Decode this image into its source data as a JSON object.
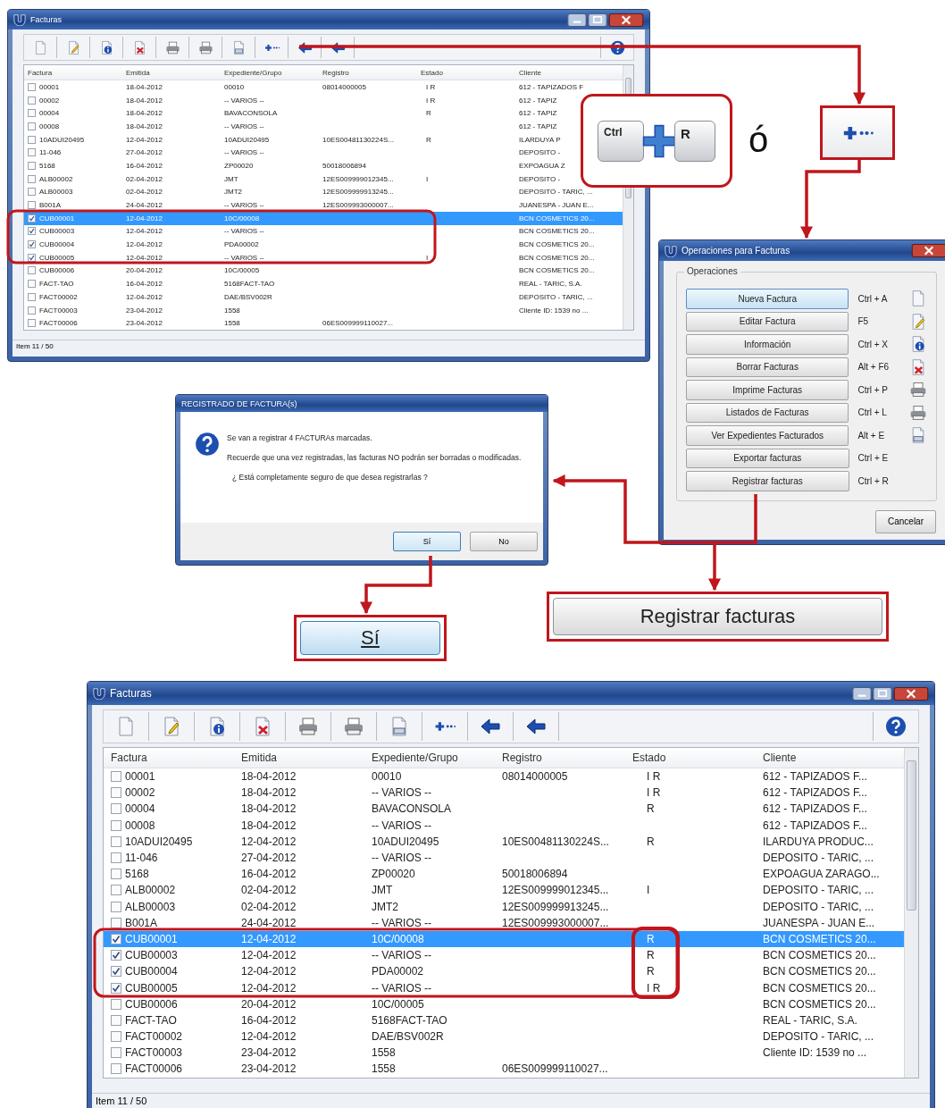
{
  "top_window": {
    "title": "Facturas",
    "columns": [
      "Factura",
      "Emitida",
      "Expediente/Grupo",
      "Registro",
      "Estado",
      "Cliente"
    ],
    "rows": [
      {
        "factura": "00001",
        "emitida": "18-04-2012",
        "expediente": "00010",
        "registro": "08014000005",
        "estado": "I R",
        "cliente": "612 - TAPIZADOS F",
        "checked": false,
        "selected": false
      },
      {
        "factura": "00002",
        "emitida": "18-04-2012",
        "expediente": "-- VARIOS --",
        "estado": "I R",
        "cliente": "612 - TAPIZ",
        "checked": false,
        "selected": false
      },
      {
        "factura": "00004",
        "emitida": "18-04-2012",
        "expediente": "BAVACONSOLA",
        "estado": "R",
        "cliente": "612 - TAPIZ",
        "checked": false,
        "selected": false
      },
      {
        "factura": "00008",
        "emitida": "18-04-2012",
        "expediente": "-- VARIOS --",
        "cliente": "612 - TAPIZ",
        "checked": false,
        "selected": false
      },
      {
        "factura": "10ADUI20495",
        "emitida": "12-04-2012",
        "expediente": "10ADUI20495",
        "registro": "10ES00481130224S...",
        "estado": "R",
        "cliente": "ILARDUYA P",
        "checked": false,
        "selected": false
      },
      {
        "factura": "11-046",
        "emitida": "27-04-2012",
        "expediente": "-- VARIOS --",
        "cliente": "DEPOSITO -",
        "checked": false,
        "selected": false
      },
      {
        "factura": "5168",
        "emitida": "16-04-2012",
        "expediente": "ZP00020",
        "registro": "50018006894",
        "cliente": "EXPOAGUA Z",
        "checked": false,
        "selected": false
      },
      {
        "factura": "ALB00002",
        "emitida": "02-04-2012",
        "expediente": "JMT",
        "registro": "12ES009999012345...",
        "estado": "I",
        "cliente": "DEPOSITO -",
        "checked": false,
        "selected": false
      },
      {
        "factura": "ALB00003",
        "emitida": "02-04-2012",
        "expediente": "JMT2",
        "registro": "12ES009999913245...",
        "cliente": "DEPOSITO - TARIC, ...",
        "checked": false,
        "selected": false
      },
      {
        "factura": "B001A",
        "emitida": "24-04-2012",
        "expediente": "-- VARIOS --",
        "registro": "12ES009993000007...",
        "cliente": "JUANESPA - JUAN E...",
        "checked": false,
        "selected": false
      },
      {
        "factura": "CUB00001",
        "emitida": "12-04-2012",
        "expediente": "10C/00008",
        "cliente": "BCN COSMETICS 20...",
        "checked": true,
        "selected": true
      },
      {
        "factura": "CUB00003",
        "emitida": "12-04-2012",
        "expediente": "-- VARIOS --",
        "cliente": "BCN COSMETICS 20...",
        "checked": true,
        "selected": false
      },
      {
        "factura": "CUB00004",
        "emitida": "12-04-2012",
        "expediente": "PDA00002",
        "cliente": "BCN COSMETICS 20...",
        "checked": true,
        "selected": false
      },
      {
        "factura": "CUB00005",
        "emitida": "12-04-2012",
        "expediente": "-- VARIOS --",
        "estado": "I",
        "cliente": "BCN COSMETICS 20...",
        "checked": true,
        "selected": false
      },
      {
        "factura": "CUB00006",
        "emitida": "20-04-2012",
        "expediente": "10C/00005",
        "cliente": "BCN COSMETICS 20...",
        "checked": false,
        "selected": false
      },
      {
        "factura": "FACT-TAO",
        "emitida": "16-04-2012",
        "expediente": "5168FACT-TAO",
        "cliente": "REAL - TARIC, S.A.",
        "checked": false,
        "selected": false
      },
      {
        "factura": "FACT00002",
        "emitida": "12-04-2012",
        "expediente": "DAE/BSV002R",
        "cliente": "DEPOSITO - TARIC, ...",
        "checked": false,
        "selected": false
      },
      {
        "factura": "FACT00003",
        "emitida": "23-04-2012",
        "expediente": "1558",
        "cliente": "Cliente ID: 1539 no ...",
        "checked": false,
        "selected": false
      },
      {
        "factura": "FACT00006",
        "emitida": "23-04-2012",
        "expediente": "1558",
        "registro": "06ES009999110027...",
        "checked": false,
        "selected": false
      }
    ],
    "status": "Item 11 / 50"
  },
  "shortcut_callout": {
    "keys": [
      "Ctrl",
      "R"
    ],
    "separator": "ó"
  },
  "operations_dialog": {
    "title": "Operaciones para Facturas",
    "group": "Operaciones",
    "operations": [
      {
        "label": "Nueva Factura",
        "shortcut": "Ctrl + A"
      },
      {
        "label": "Editar Factura",
        "shortcut": "F5"
      },
      {
        "label": "Información",
        "shortcut": "Ctrl + X"
      },
      {
        "label": "Borrar Facturas",
        "shortcut": "Alt + F6"
      },
      {
        "label": "Imprime Facturas",
        "shortcut": "Ctrl + P"
      },
      {
        "label": "Listados de Facturas",
        "shortcut": "Ctrl + L"
      },
      {
        "label": "Ver Expedientes Facturados",
        "shortcut": "Alt + E"
      },
      {
        "label": "Exportar facturas",
        "shortcut": "Ctrl + E"
      },
      {
        "label": "Registrar facturas",
        "shortcut": "Ctrl + R"
      }
    ],
    "cancel": "Cancelar"
  },
  "confirm_dialog": {
    "title": "REGISTRADO DE FACTURA(s)",
    "message": "Se van a registrar 4 FACTURAs marcadas.",
    "warning": "Recuerde que una vez registradas, las facturas NO podrán ser borradas o modificadas.",
    "question": "¿ Está completamente seguro de que desea registrarlas ?",
    "yes": "Sí",
    "no": "No"
  },
  "zoomed_register_button": "Registrar facturas",
  "zoomed_yes_button": "Sí",
  "bottom_window": {
    "title": "Facturas",
    "columns": [
      "Factura",
      "Emitida",
      "Expediente/Grupo",
      "Registro",
      "Estado",
      "Cliente"
    ],
    "rows": [
      {
        "factura": "00001",
        "emitida": "18-04-2012",
        "expediente": "00010",
        "registro": "08014000005",
        "estado": "I R",
        "cliente": "612 - TAPIZADOS F...",
        "checked": false,
        "selected": false
      },
      {
        "factura": "00002",
        "emitida": "18-04-2012",
        "expediente": "-- VARIOS --",
        "estado": "I R",
        "cliente": "612 - TAPIZADOS F...",
        "checked": false,
        "selected": false
      },
      {
        "factura": "00004",
        "emitida": "18-04-2012",
        "expediente": "BAVACONSOLA",
        "estado": "R",
        "cliente": "612 - TAPIZADOS F...",
        "checked": false,
        "selected": false
      },
      {
        "factura": "00008",
        "emitida": "18-04-2012",
        "expediente": "-- VARIOS --",
        "cliente": "612 - TAPIZADOS F...",
        "checked": false,
        "selected": false
      },
      {
        "factura": "10ADUI20495",
        "emitida": "12-04-2012",
        "expediente": "10ADUI20495",
        "registro": "10ES00481130224S...",
        "estado": "R",
        "cliente": "ILARDUYA PRODUC...",
        "checked": false,
        "selected": false
      },
      {
        "factura": "11-046",
        "emitida": "27-04-2012",
        "expediente": "-- VARIOS --",
        "cliente": "DEPOSITO - TARIC, ...",
        "checked": false,
        "selected": false
      },
      {
        "factura": "5168",
        "emitida": "16-04-2012",
        "expediente": "ZP00020",
        "registro": "50018006894",
        "cliente": "EXPOAGUA ZARAGO...",
        "checked": false,
        "selected": false
      },
      {
        "factura": "ALB00002",
        "emitida": "02-04-2012",
        "expediente": "JMT",
        "registro": "12ES009999012345...",
        "estado": "I",
        "cliente": "DEPOSITO - TARIC, ...",
        "checked": false,
        "selected": false
      },
      {
        "factura": "ALB00003",
        "emitida": "02-04-2012",
        "expediente": "JMT2",
        "registro": "12ES009999913245...",
        "cliente": "DEPOSITO - TARIC, ...",
        "checked": false,
        "selected": false
      },
      {
        "factura": "B001A",
        "emitida": "24-04-2012",
        "expediente": "-- VARIOS --",
        "registro": "12ES009993000007...",
        "cliente": "JUANESPA - JUAN E...",
        "checked": false,
        "selected": false
      },
      {
        "factura": "CUB00001",
        "emitida": "12-04-2012",
        "expediente": "10C/00008",
        "estado": "R",
        "cliente": "BCN COSMETICS 20...",
        "checked": true,
        "selected": true
      },
      {
        "factura": "CUB00003",
        "emitida": "12-04-2012",
        "expediente": "-- VARIOS --",
        "estado": "R",
        "cliente": "BCN COSMETICS 20...",
        "checked": true,
        "selected": false
      },
      {
        "factura": "CUB00004",
        "emitida": "12-04-2012",
        "expediente": "PDA00002",
        "estado": "R",
        "cliente": "BCN COSMETICS 20...",
        "checked": true,
        "selected": false
      },
      {
        "factura": "CUB00005",
        "emitida": "12-04-2012",
        "expediente": "-- VARIOS --",
        "estado": "I R",
        "cliente": "BCN COSMETICS 20...",
        "checked": true,
        "selected": false
      },
      {
        "factura": "CUB00006",
        "emitida": "20-04-2012",
        "expediente": "10C/00005",
        "cliente": "BCN COSMETICS 20...",
        "checked": false,
        "selected": false
      },
      {
        "factura": "FACT-TAO",
        "emitida": "16-04-2012",
        "expediente": "5168FACT-TAO",
        "cliente": "REAL - TARIC, S.A.",
        "checked": false,
        "selected": false
      },
      {
        "factura": "FACT00002",
        "emitida": "12-04-2012",
        "expediente": "DAE/BSV002R",
        "cliente": "DEPOSITO - TARIC, ...",
        "checked": false,
        "selected": false
      },
      {
        "factura": "FACT00003",
        "emitida": "23-04-2012",
        "expediente": "1558",
        "cliente": "Cliente ID: 1539 no ...",
        "checked": false,
        "selected": false
      },
      {
        "factura": "FACT00006",
        "emitida": "23-04-2012",
        "expediente": "1558",
        "registro": "06ES009999110027...",
        "checked": false,
        "selected": false
      }
    ],
    "status": "Item 11 / 50"
  }
}
